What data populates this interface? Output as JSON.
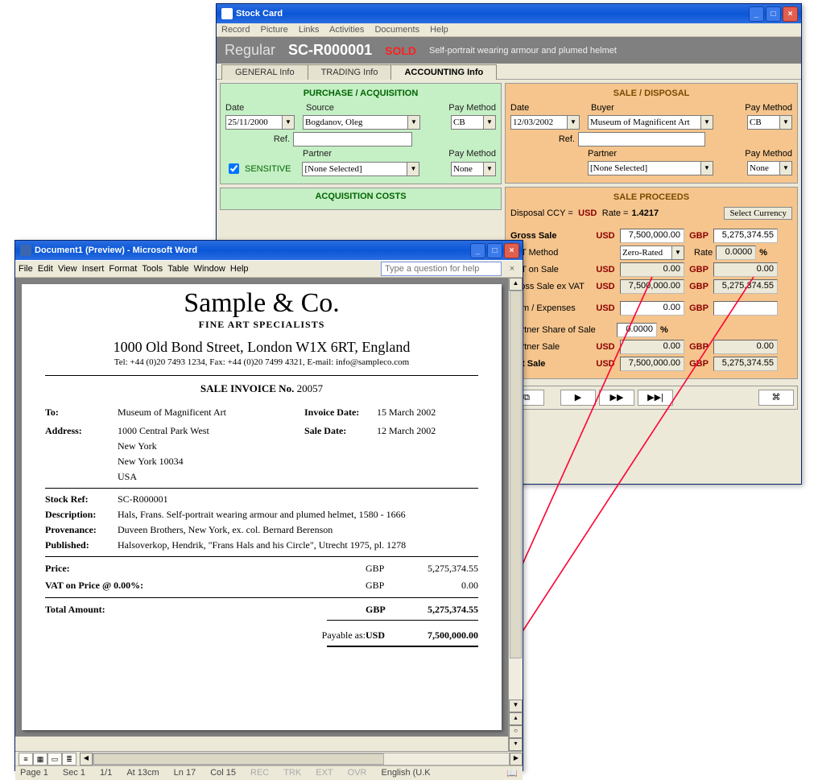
{
  "stockcard": {
    "title": "Stock Card",
    "menus": [
      "Record",
      "Picture",
      "Links",
      "Activities",
      "Documents",
      "Help"
    ],
    "band": {
      "category": "Regular",
      "code": "SC-R000001",
      "status": "SOLD",
      "desc": "Self-portrait wearing armour and plumed helmet"
    },
    "tabs": [
      "GENERAL Info",
      "TRADING Info",
      "ACCOUNTING Info"
    ],
    "purchase": {
      "title": "PURCHASE / ACQUISITION",
      "date_lbl": "Date",
      "date": "25/11/2000",
      "source_lbl": "Source",
      "source": "Bogdanov, Oleg",
      "paymethod_lbl": "Pay Method",
      "paymethod": "CB",
      "ref_lbl": "Ref.",
      "ref": "",
      "partner_lbl": "Partner",
      "partner": "[None Selected]",
      "paymethod2": "None",
      "sensitive_lbl": "SENSITIVE"
    },
    "acq_costs": {
      "title": "ACQUISITION COSTS"
    },
    "sale": {
      "title": "SALE / DISPOSAL",
      "date_lbl": "Date",
      "date": "12/03/2002",
      "buyer_lbl": "Buyer",
      "buyer": "Museum of Magnificent Art",
      "paymethod_lbl": "Pay Method",
      "paymethod": "CB",
      "ref_lbl": "Ref.",
      "ref": "",
      "partner_lbl": "Partner",
      "partner": "[None Selected]",
      "paymethod2": "None"
    },
    "proceeds": {
      "title": "SALE PROCEEDS",
      "disposal_ccy_lbl": "Disposal CCY  =",
      "disposal_ccy": "USD",
      "rate_lbl": "Rate  =",
      "rate": "1.4217",
      "select_ccy": "Select Currency",
      "gross_lbl": "Gross Sale",
      "gross_usd": "7,500,000.00",
      "gross_gbp": "5,275,374.55",
      "vat_method_lbl": "VAT Method",
      "vat_method": "Zero-Rated",
      "vrate_lbl": "Rate",
      "vrate": "0.0000",
      "pct": "%",
      "vat_on_sale_lbl": "VAT on Sale",
      "vat_on_sale_usd": "0.00",
      "vat_on_sale_gbp": "0.00",
      "gross_ex_lbl": "Gross Sale ex VAT",
      "gross_ex_usd": "7,500,000.00",
      "gross_ex_gbp": "5,275,374.55",
      "com_lbl": "Com / Expenses",
      "com_usd": "0.00",
      "com_gbp": "",
      "pshare_lbl": "Partner Share of Sale",
      "pshare": "0.0000",
      "psale_lbl": "Partner Sale",
      "psale_usd": "0.00",
      "psale_gbp": "0.00",
      "net_lbl": "Net Sale",
      "net_usd": "7,500,000.00",
      "net_gbp": "5,275,374.55",
      "usd": "USD",
      "gbp": "GBP"
    }
  },
  "word": {
    "title": "Document1 (Preview) - Microsoft Word",
    "menus": [
      "File",
      "Edit",
      "View",
      "Insert",
      "Format",
      "Tools",
      "Table",
      "Window",
      "Help"
    ],
    "qhelp_ph": "Type a question for help",
    "status": {
      "page": "Page  1",
      "sec": "Sec  1",
      "pg": "1/1",
      "at": "At  13cm",
      "ln": "Ln  17",
      "col": "Col  15",
      "rec": "REC",
      "trk": "TRK",
      "ext": "EXT",
      "ovr": "OVR",
      "lang": "English (U.K"
    },
    "doc": {
      "company": "Sample & Co.",
      "tagline": "FINE ART SPECIALISTS",
      "addr": "1000 Old Bond Street, London W1X 6RT, England",
      "contact": "Tel: +44 (0)20 7493 1234,   Fax: +44 (0)20 7499 4321, E-mail: info@sampleco.com",
      "inv_title": "SALE INVOICE   No.",
      "inv_no": "20057",
      "to_lbl": "To:",
      "to": "Museum of Magnificent Art",
      "invdate_lbl": "Invoice Date:",
      "invdate": "15 March 2002",
      "addr_lbl": "Address:",
      "addr1": "1000 Central Park West",
      "addr2": "New York",
      "addr3": "New York 10034",
      "addr4": "USA",
      "saledate_lbl": "Sale Date:",
      "saledate": "12 March 2002",
      "stockref_lbl": "Stock Ref:",
      "stockref": "SC-R000001",
      "desc_lbl": "Description:",
      "desc": "Hals, Frans.  Self-portrait wearing armour and plumed helmet, 1580 - 1666",
      "prov_lbl": "Provenance:",
      "prov": "Duveen Brothers, New York, ex. col. Bernard Berenson",
      "pub_lbl": "Published:",
      "pub": "Halsoverkop, Hendrik, \"Frans Hals and his Circle\", Utrecht 1975, pl. 1278",
      "price_lbl": "Price:",
      "price_ccy": "GBP",
      "price": "5,275,374.55",
      "vat_lbl": "VAT on Price @ 0.00%:",
      "vat_ccy": "GBP",
      "vat": "0.00",
      "total_lbl": "Total Amount:",
      "total_ccy": "GBP",
      "total": "5,275,374.55",
      "payable_lbl": "Payable as:",
      "payable_ccy": "USD",
      "payable": "7,500,000.00"
    }
  }
}
